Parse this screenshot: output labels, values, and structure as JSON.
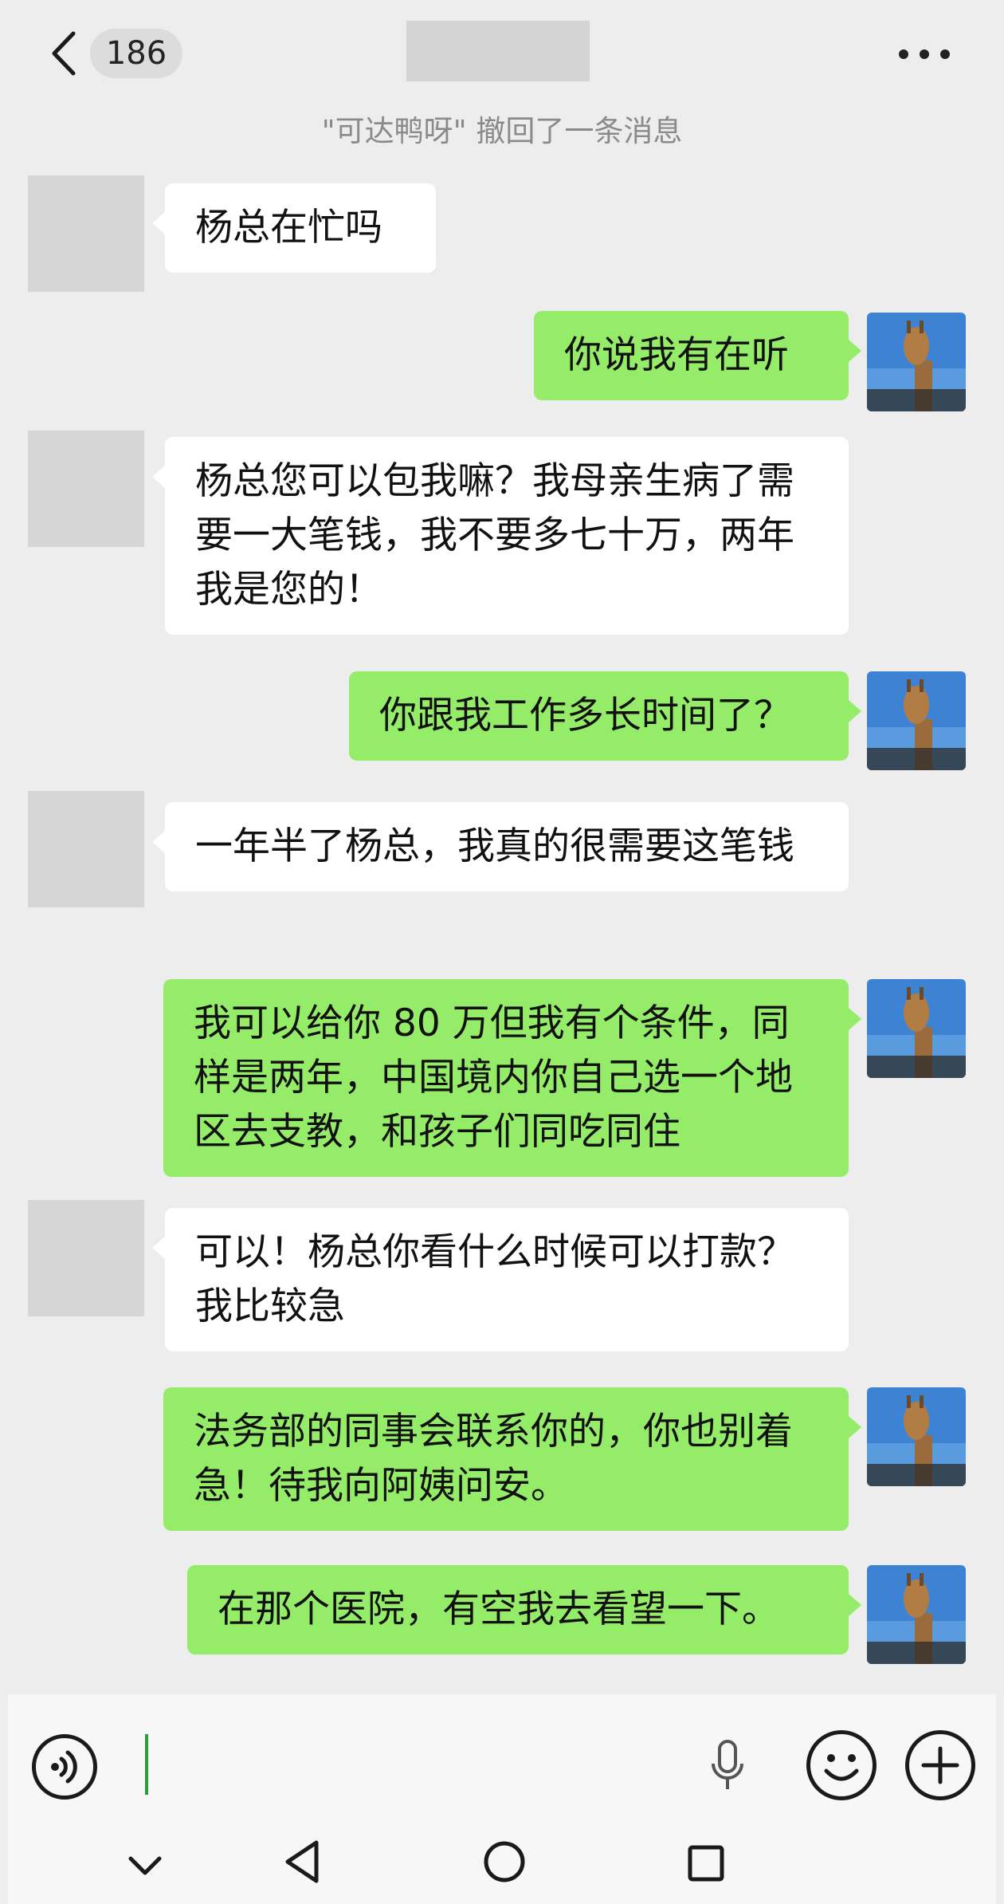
{
  "header": {
    "back_label": "back",
    "unread_count": "186",
    "title_hidden": ""
  },
  "system_message": "\"可达鸭呀\" 撤回了一条消息",
  "messages": [
    {
      "side": "left",
      "text": "杨总在忙吗"
    },
    {
      "side": "right",
      "text": "你说我有在听"
    },
    {
      "side": "left",
      "text": "杨总您可以包我嘛？我母亲生病了需要一大笔钱，我不要多七十万，两年我是您的！"
    },
    {
      "side": "right",
      "text": "你跟我工作多长时间了？"
    },
    {
      "side": "left",
      "text": "一年半了杨总，我真的很需要这笔钱"
    },
    {
      "side": "right",
      "text": "我可以给你 80 万但我有个条件，同样是两年，中国境内你自己选一个地区去支教，和孩子们同吃同住"
    },
    {
      "side": "left",
      "text": "可以！杨总你看什么时候可以打款？我比较急"
    },
    {
      "side": "right",
      "text": "法务部的同事会联系你的，你也别着急！待我向阿姨问安。"
    },
    {
      "side": "right",
      "text": "在那个医院，有空我去看望一下。"
    }
  ],
  "input": {
    "value": ""
  },
  "icons": {
    "voice": "voice-icon",
    "mic": "mic-icon",
    "emoji": "emoji-icon",
    "add": "plus-icon"
  },
  "colors": {
    "self_bubble": "#95ec69",
    "other_bubble": "#ffffff",
    "background": "#ededed"
  }
}
